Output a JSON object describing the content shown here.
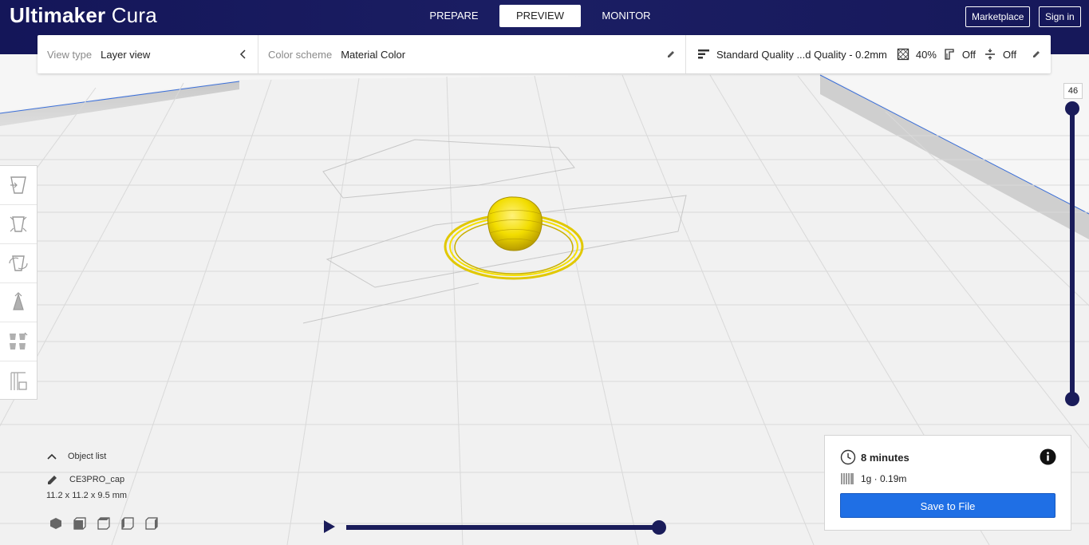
{
  "app": {
    "logo_bold": "Ultimaker",
    "logo_light": "Cura"
  },
  "stages": [
    {
      "label": "PREPARE"
    },
    {
      "label": "PREVIEW"
    },
    {
      "label": "MONITOR"
    }
  ],
  "header": {
    "marketplace": "Marketplace",
    "signin": "Sign in"
  },
  "toolbar": {
    "view_type_label": "View type",
    "view_type_value": "Layer view",
    "color_scheme_label": "Color scheme",
    "color_scheme_value": "Material Color",
    "profile": "Standard Quality ...d Quality - 0.2mm",
    "infill": "40%",
    "support": "Off",
    "adhesion": "Off"
  },
  "layer_slider": {
    "current_layer": "46",
    "top_value": 46
  },
  "object_list": {
    "header": "Object list",
    "object_name": "CE3PRO_cap",
    "dimensions": "11.2 x 11.2 x 9.5 mm"
  },
  "playback": {
    "progress": 1.0
  },
  "print_info": {
    "time": "8 minutes",
    "material": "1g · 0.19m",
    "save_button": "Save to File"
  },
  "colors": {
    "header_bg": "#1b1d5c",
    "accent_blue": "#1f6fe5",
    "slider": "#1a1c5a",
    "model_yellow": "#f5e000"
  }
}
